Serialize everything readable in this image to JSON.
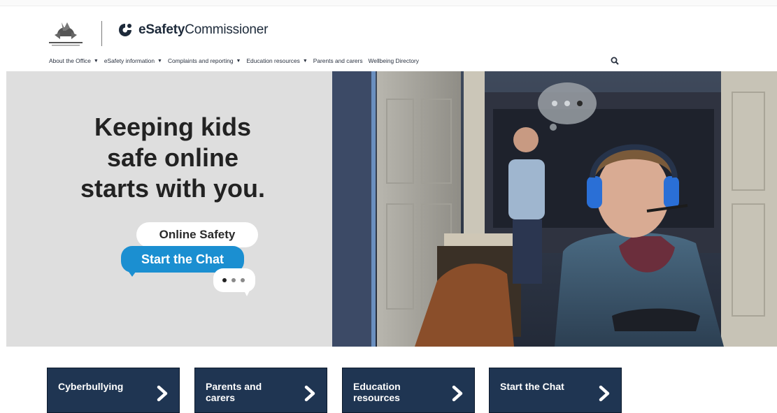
{
  "header": {
    "brand_prefix": "eSafety",
    "brand_suffix": "Commissioner"
  },
  "nav": {
    "items": [
      {
        "label": "About the Office",
        "has_menu": true
      },
      {
        "label": "eSafety information",
        "has_menu": true
      },
      {
        "label": "Complaints and reporting",
        "has_menu": true
      },
      {
        "label": "Education resources",
        "has_menu": true
      },
      {
        "label": "Parents and carers",
        "has_menu": false
      },
      {
        "label": "Wellbeing Directory",
        "has_menu": false
      }
    ],
    "search_icon": "search-icon"
  },
  "hero": {
    "title_lines": [
      "Keeping kids",
      "safe online",
      "starts with you."
    ],
    "bubble_top": "Online Safety",
    "bubble_main": "Start the Chat"
  },
  "tiles": [
    {
      "label": "Cyberbullying"
    },
    {
      "label": "Parents and carers"
    },
    {
      "label": "Education resources"
    },
    {
      "label": "Start the Chat"
    }
  ],
  "colors": {
    "navy": "#1f3552",
    "accent_blue": "#1b8fd1",
    "hero_grey": "#dedede",
    "text_dark": "#222222"
  }
}
